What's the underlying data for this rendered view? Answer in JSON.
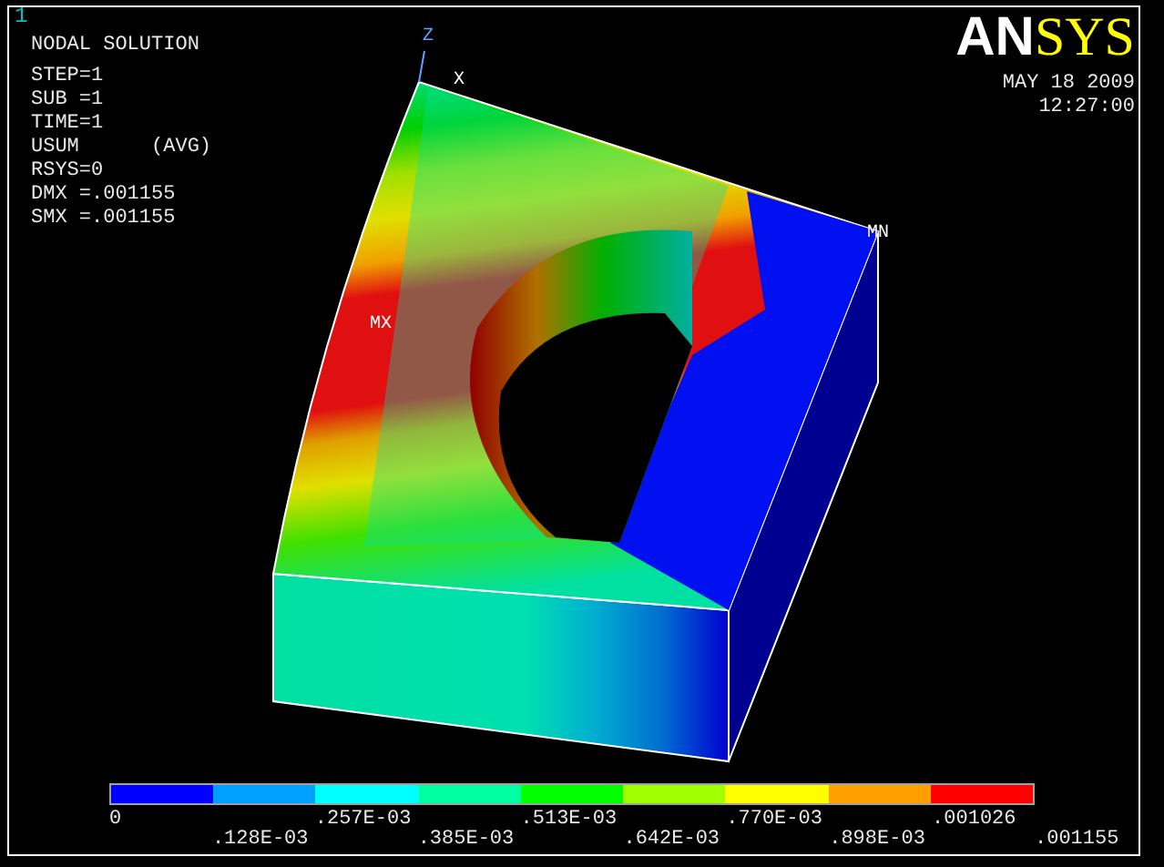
{
  "window_number": "1",
  "title": "NODAL SOLUTION",
  "info_lines": [
    "STEP=1",
    "SUB =1",
    "TIME=1",
    "USUM      (AVG)",
    "RSYS=0",
    "DMX =.001155",
    "SMX =.001155"
  ],
  "logo": {
    "lead": "AN",
    "tail": "SYS"
  },
  "date": "MAY 18 2009",
  "time": "12:27:00",
  "model_labels": {
    "z_axis": "Z",
    "x_axis": "X",
    "max": "MX",
    "min": "MN"
  },
  "legend": {
    "bands": [
      {
        "color": "#0000ff"
      },
      {
        "color": "#00a0ff"
      },
      {
        "color": "#00ffff"
      },
      {
        "color": "#00ffa0"
      },
      {
        "color": "#00ff00"
      },
      {
        "color": "#a0ff00"
      },
      {
        "color": "#ffff00"
      },
      {
        "color": "#ffa000"
      },
      {
        "color": "#ff0000"
      }
    ],
    "ticks": [
      "0",
      ".128E-03",
      ".257E-03",
      ".385E-03",
      ".513E-03",
      ".642E-03",
      ".770E-03",
      ".898E-03",
      ".001026",
      ".001155"
    ]
  }
}
